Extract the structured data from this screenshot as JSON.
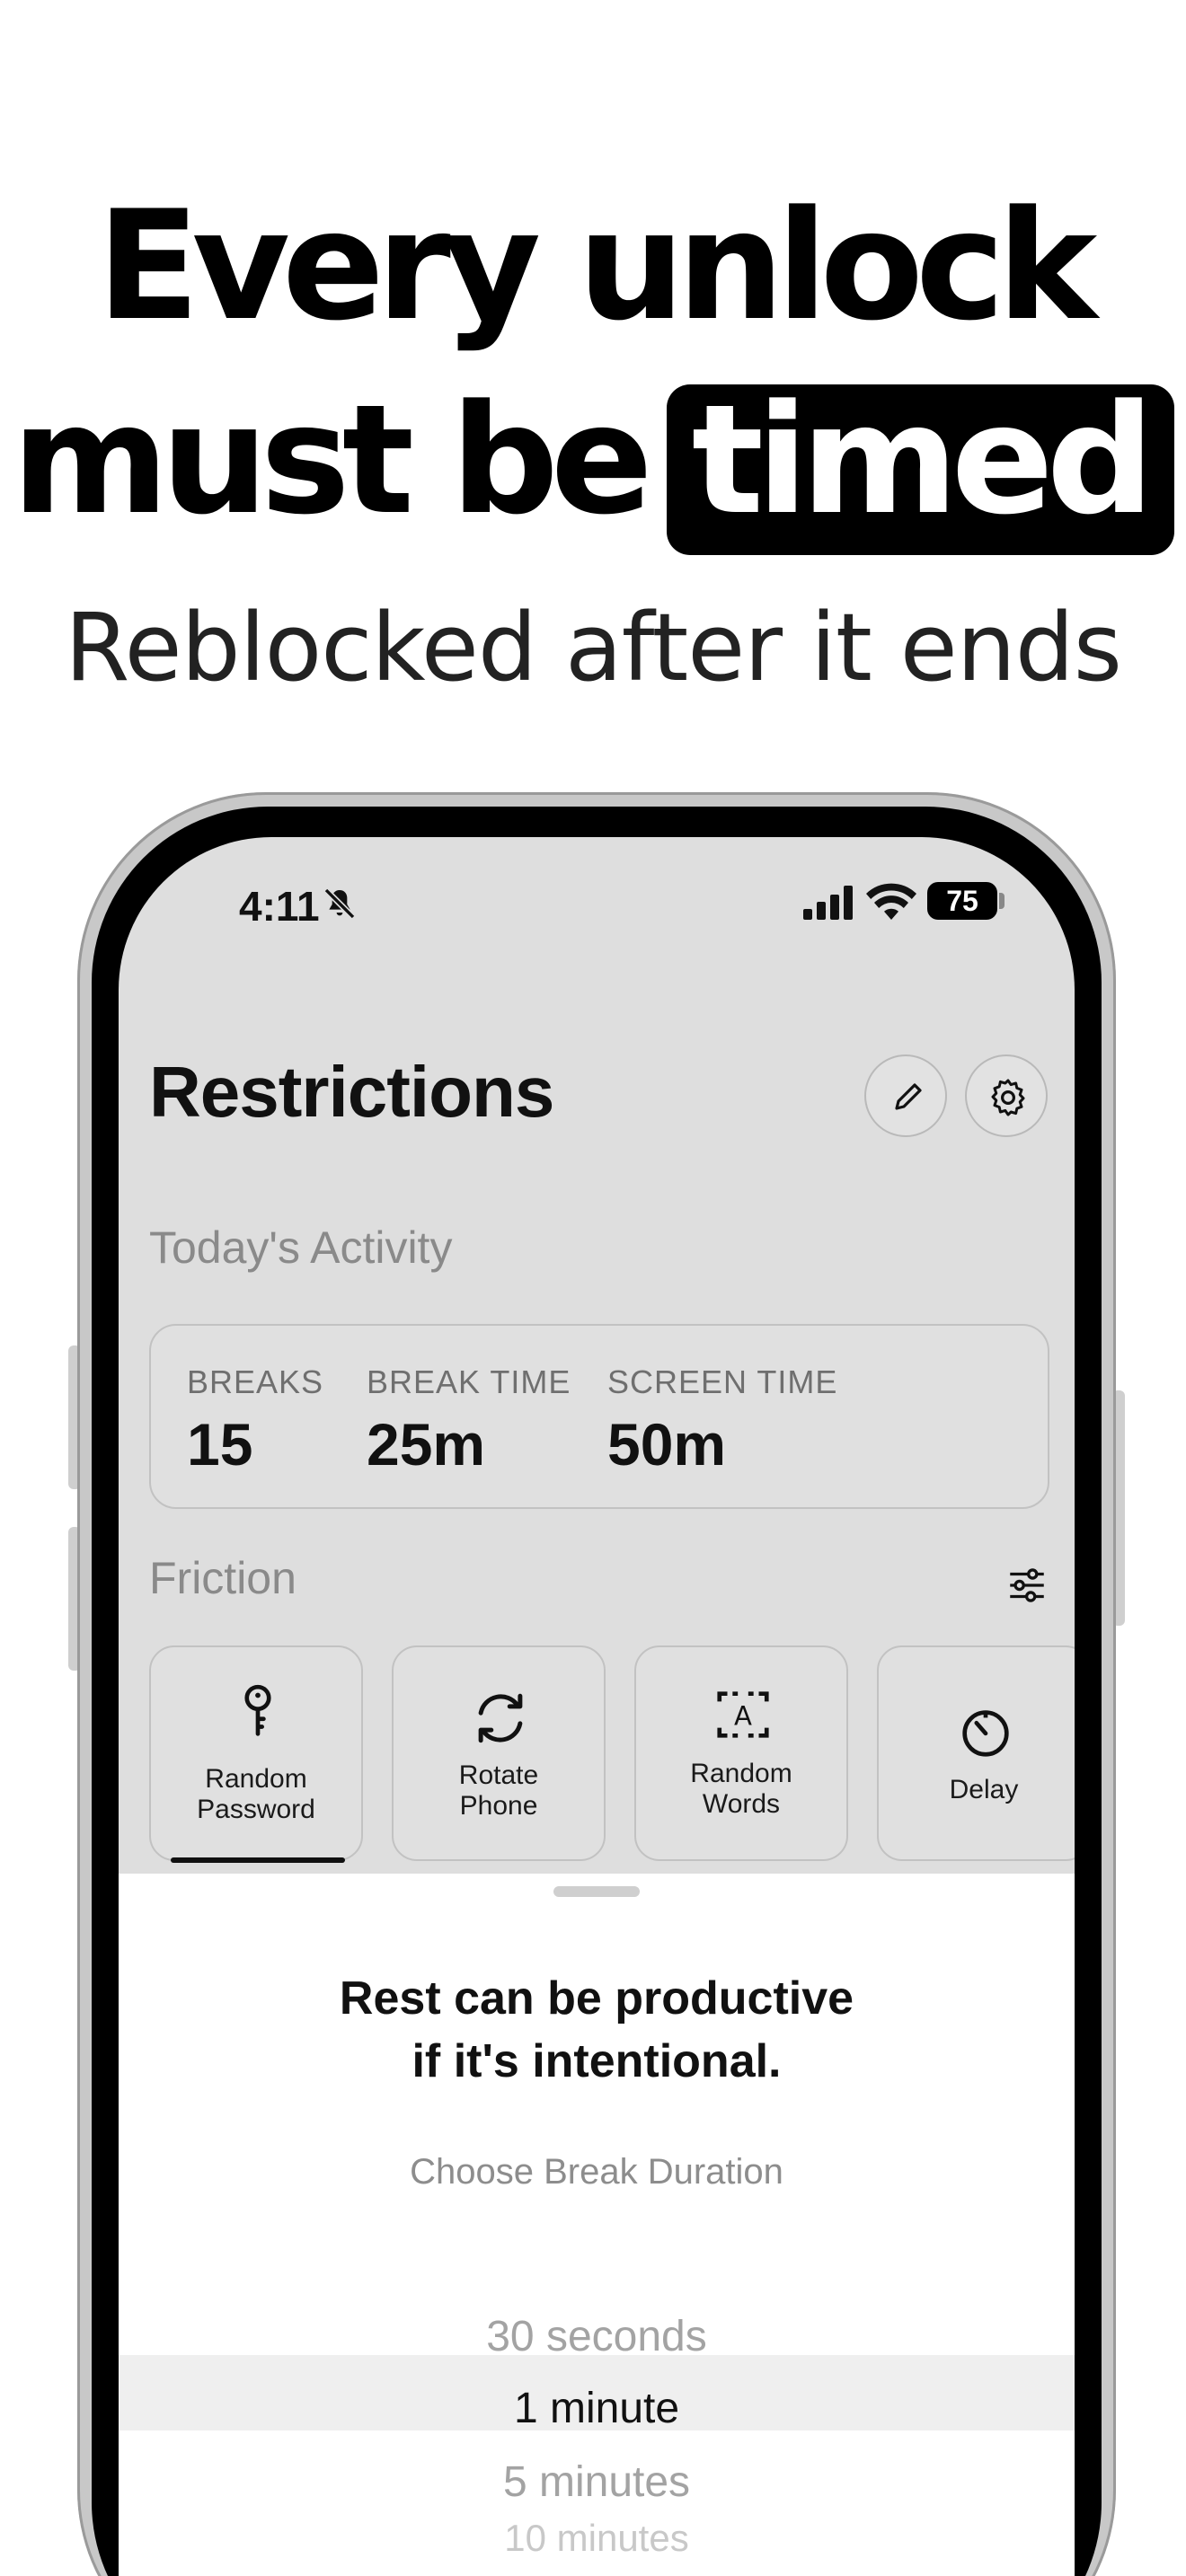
{
  "headline": {
    "line1": "Every unlock",
    "line2_prefix": "must be",
    "line2_highlight": "timed",
    "subtitle": "Reblocked after it ends"
  },
  "status_bar": {
    "time": "4:11",
    "battery": "75",
    "icons": [
      "bell-slash-icon",
      "signal-icon",
      "wifi-icon",
      "battery-icon"
    ]
  },
  "page": {
    "title": "Restrictions",
    "buttons": [
      "pencil-icon",
      "gear-icon"
    ]
  },
  "activity": {
    "label": "Today's Activity",
    "stats": [
      {
        "label": "BREAKS",
        "value": "15"
      },
      {
        "label": "BREAK TIME",
        "value": "25m"
      },
      {
        "label": "SCREEN TIME",
        "value": "50m"
      }
    ]
  },
  "friction": {
    "label": "Friction",
    "selected": "Random Password",
    "options": [
      {
        "label_line1": "Random",
        "label_line2": "Password",
        "icon": "key-icon"
      },
      {
        "label_line1": "Rotate",
        "label_line2": "Phone",
        "icon": "rotate-icon"
      },
      {
        "label_line1": "Random",
        "label_line2": "Words",
        "icon": "text-box-icon"
      },
      {
        "label_line1": "Delay",
        "label_line2": "",
        "icon": "timer-icon"
      }
    ]
  },
  "sheet": {
    "title_line1": "Rest can be productive",
    "title_line2": "if it's intentional.",
    "subtitle": "Choose Break Duration",
    "options": [
      "30 seconds",
      "1 minute",
      "5 minutes",
      "10 minutes"
    ],
    "selected": "1 minute"
  }
}
